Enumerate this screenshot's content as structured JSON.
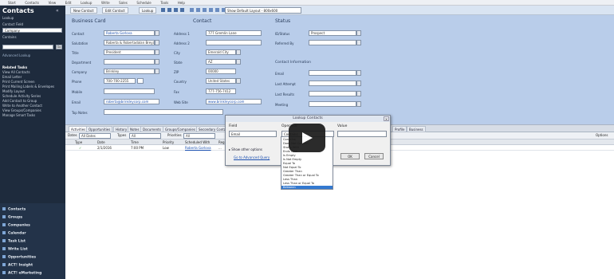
{
  "menubar": [
    "Start",
    "Contacts",
    "View",
    "Edit",
    "Lookup",
    "Write",
    "Sales",
    "Schedule",
    "Tools",
    "Help"
  ],
  "sidebar": {
    "title": "Contacts",
    "close": "«",
    "lookup_label": "Lookup",
    "contact_field_label": "Contact Field",
    "contact_field_value": "Company",
    "contains_label": "Contains",
    "contains_value": "",
    "go_label": "Go",
    "advanced_label": "Advanced Lookup",
    "related_tasks_title": "Related Tasks",
    "related_tasks": [
      "View All Contacts",
      "Email Letter",
      "Print Current Screen",
      "Print Mailing Labels & Envelopes",
      "Modify Layout",
      "Schedule Activity Series",
      "Add Contact to Group",
      "Write to Another Contact",
      "View Groups/Companies",
      "Manage Smart Tasks"
    ],
    "nav": [
      "Contacts",
      "Groups",
      "Companies",
      "Calendar",
      "Task List",
      "Write List",
      "Opportunities",
      "ACT! Insight",
      "ACT! eMarketing"
    ]
  },
  "toolbar": {
    "buttons": [
      "New Contact",
      "Edit Contact",
      "Lookup"
    ],
    "layout": "Show Default Layout - 800x600"
  },
  "form": {
    "section_business": "Business Card",
    "section_contact": "Contact",
    "section_status": "Status",
    "section_contact_info": "Contact Information",
    "left": [
      {
        "label": "Contact",
        "value": "Roberta Gorlova"
      },
      {
        "label": "Salutation",
        "value": "Roberta & Robertadalan Breya"
      },
      {
        "label": "Title",
        "value": "President"
      },
      {
        "label": "Department",
        "value": ""
      },
      {
        "label": "Company",
        "value": "Brinkley"
      },
      {
        "label": "Phone",
        "value": "700-700-2255"
      },
      {
        "label": "Mobile",
        "value": ""
      },
      {
        "label": "Email",
        "value": "roberta@brinkleycorp.com"
      },
      {
        "label": "Top Notes",
        "value": ""
      }
    ],
    "mid": [
      {
        "label": "Address 1",
        "value": "777 Gremlin Lane"
      },
      {
        "label": "Address 2",
        "value": ""
      },
      {
        "label": "City",
        "value": "Emerald City"
      },
      {
        "label": "State",
        "value": "AZ"
      },
      {
        "label": "ZIP",
        "value": "00000"
      },
      {
        "label": "Country",
        "value": "United States"
      },
      {
        "label": "Fax",
        "value": "777-756-7412"
      },
      {
        "label": "Web Site",
        "value": "www.brinkleycorp.com"
      }
    ],
    "right": [
      {
        "label": "ID/Status",
        "value": "Prospect"
      },
      {
        "label": "Referred By",
        "value": ""
      },
      {
        "label": "Email",
        "value": ""
      },
      {
        "label": "Last Attempt",
        "value": ""
      },
      {
        "label": "Last Results",
        "value": ""
      },
      {
        "label": "Meeting",
        "value": ""
      }
    ]
  },
  "tabs": [
    "Activities",
    "Opportunities",
    "History",
    "Notes",
    "Documents",
    "Groups/Companies",
    "Secondary Contacts",
    "Relationships",
    "Web Info",
    "Personal Info",
    "Contact Access",
    "User Fields",
    "Profile",
    "Vitals",
    "Business"
  ],
  "gridbar": {
    "dates_label": "Dates",
    "dates_value": "All Dates",
    "types_label": "Types",
    "types_value": "All",
    "priorities_label": "Priorities",
    "priorities_value": "All",
    "options_label": "Options"
  },
  "grid": {
    "headers": [
      "Type",
      "Date",
      "Time",
      "Priority",
      "Scheduled With",
      "Regarding"
    ],
    "row": [
      "✓",
      "2/1/2016",
      "7:00 PM",
      "Low",
      "Roberta Gorlova",
      "..."
    ]
  },
  "dialog": {
    "title": "Lookup Contacts",
    "field_label": "Field",
    "field_value": "Email",
    "operator_label": "Operator",
    "operator_value": "Contains",
    "value_label": "Value",
    "value_value": "",
    "option_replace": "Show other options",
    "link_advanced": "Go to Advanced Query",
    "ok": "OK",
    "cancel": "Cancel"
  },
  "dropdown_items": [
    "Contains",
    "Does Not Contain",
    "Starts With",
    "Ends With",
    "Is Empty",
    "Is Not Empty",
    "Equal To",
    "Not Equal To",
    "Greater Than",
    "Greater Than or Equal To",
    "Less Than",
    "Less Than or Equal To",
    "Between"
  ],
  "dropdown_selected": "Between",
  "video": {
    "play_icon": "play-icon"
  }
}
